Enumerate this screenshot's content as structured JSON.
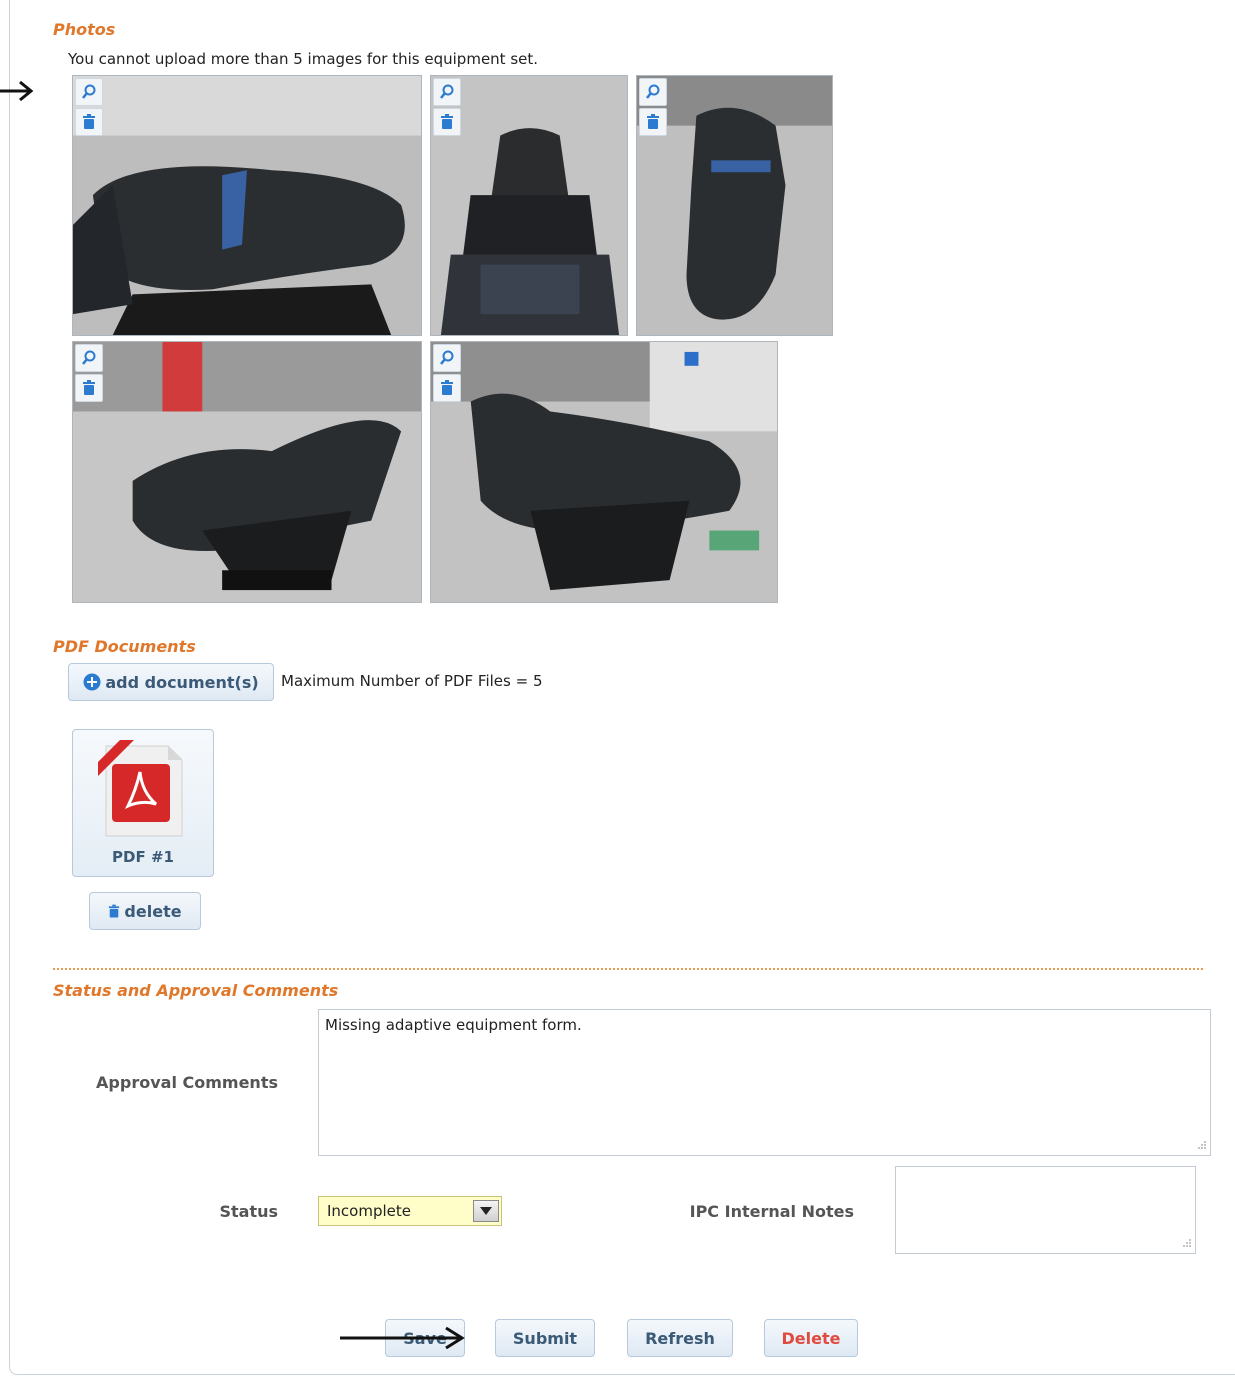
{
  "photos": {
    "title": "Photos",
    "limit_note": "You cannot upload more than 5 images for this equipment set.",
    "items": [
      {
        "name": "photo-1"
      },
      {
        "name": "photo-2"
      },
      {
        "name": "photo-3"
      },
      {
        "name": "photo-4"
      },
      {
        "name": "photo-5"
      }
    ]
  },
  "pdf": {
    "title": "PDF Documents",
    "add_button": "add document(s)",
    "max_note": "Maximum Number of PDF Files = 5",
    "items": [
      {
        "label": "PDF #1"
      }
    ],
    "delete_button": "delete"
  },
  "status_section": {
    "title": "Status and Approval Comments",
    "approval_label": "Approval Comments",
    "approval_value": "Missing adaptive equipment form.",
    "status_label": "Status",
    "status_value": "Incomplete",
    "notes_label": "IPC Internal Notes",
    "notes_value": ""
  },
  "actions": {
    "save": "Save",
    "submit": "Submit",
    "refresh": "Refresh",
    "delete": "Delete"
  },
  "colors": {
    "section_title": "#e0782c",
    "button_text": "#3b5a78",
    "danger_text": "#e04a3f",
    "status_bg": "#fffdc8"
  }
}
